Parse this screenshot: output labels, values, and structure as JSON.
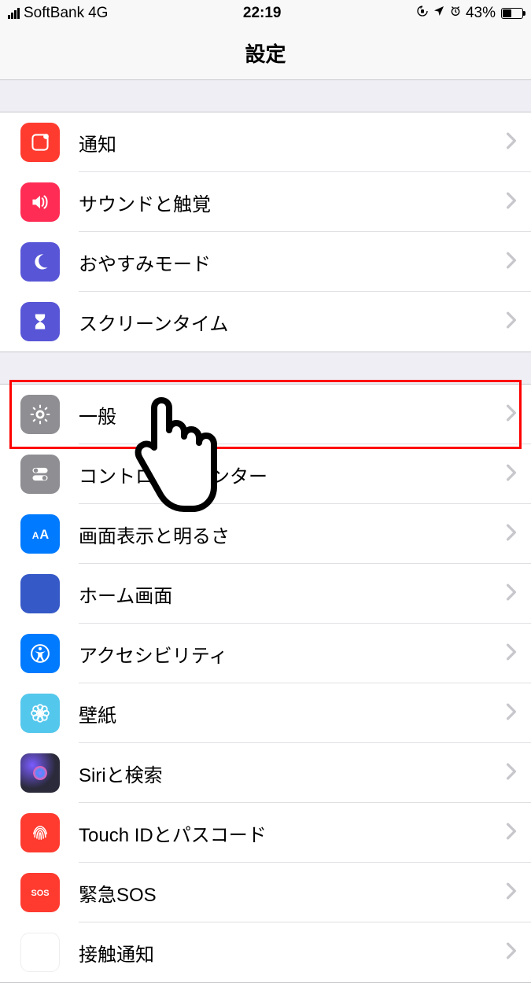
{
  "status": {
    "carrier": "SoftBank",
    "network": "4G",
    "time": "22:19",
    "battery_pct": "43%"
  },
  "header": {
    "title": "設定"
  },
  "groups": [
    {
      "rows": [
        {
          "id": "notifications",
          "label": "通知",
          "icon": "notification-icon",
          "bg": "#ff3b30"
        },
        {
          "id": "sounds",
          "label": "サウンドと触覚",
          "icon": "speaker-icon",
          "bg": "#ff2d55"
        },
        {
          "id": "dnd",
          "label": "おやすみモード",
          "icon": "moon-icon",
          "bg": "#5856d6"
        },
        {
          "id": "screentime",
          "label": "スクリーンタイム",
          "icon": "hourglass-icon",
          "bg": "#5856d6"
        }
      ]
    },
    {
      "rows": [
        {
          "id": "general",
          "label": "一般",
          "icon": "gear-icon",
          "bg": "#8e8e93"
        },
        {
          "id": "control-center",
          "label": "コントロールセンター",
          "icon": "switches-icon",
          "bg": "#8e8e93"
        },
        {
          "id": "display",
          "label": "画面表示と明るさ",
          "icon": "display-aa-icon",
          "bg": "#007aff"
        },
        {
          "id": "home",
          "label": "ホーム画面",
          "icon": "home-grid-icon",
          "bg": "#3559c7"
        },
        {
          "id": "accessibility",
          "label": "アクセシビリティ",
          "icon": "accessibility-icon",
          "bg": "#007aff"
        },
        {
          "id": "wallpaper",
          "label": "壁紙",
          "icon": "flower-icon",
          "bg": "#54c7ec"
        },
        {
          "id": "siri",
          "label": "Siriと検索",
          "icon": "siri-icon",
          "bg": "siri"
        },
        {
          "id": "touchid",
          "label": "Touch IDとパスコード",
          "icon": "fingerprint-icon",
          "bg": "#ff3b30"
        },
        {
          "id": "sos",
          "label": "緊急SOS",
          "icon": "sos-icon",
          "bg": "#ff3b30",
          "text": "SOS"
        },
        {
          "id": "exposure",
          "label": "接触通知",
          "icon": "exposure-icon",
          "bg": "exposure"
        }
      ]
    }
  ],
  "highlight": {
    "row_id": "general"
  }
}
